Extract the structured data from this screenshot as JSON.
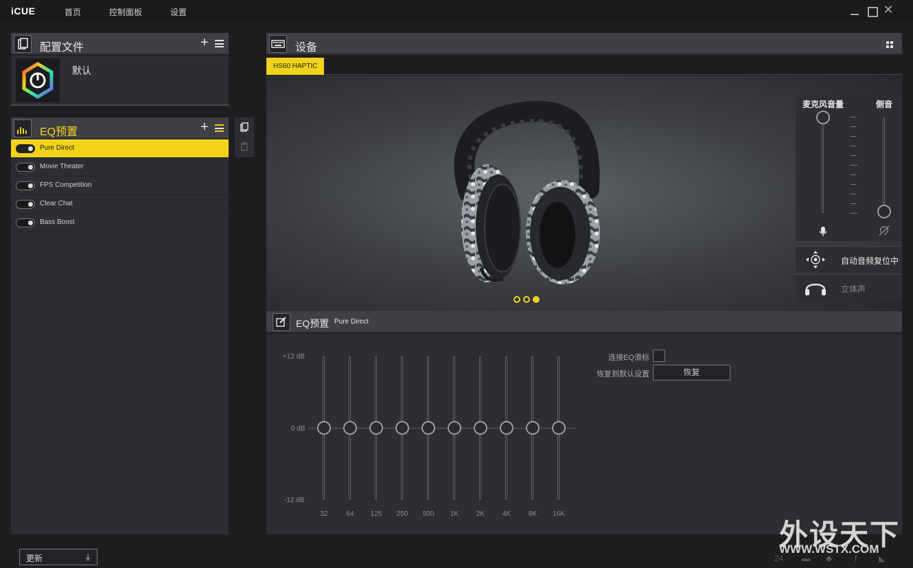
{
  "app": {
    "name": "iCUE"
  },
  "nav": [
    {
      "label": "首页"
    },
    {
      "label": "控制面板"
    },
    {
      "label": "设置"
    }
  ],
  "profiles": {
    "title": "配置文件",
    "items": [
      {
        "name": "默认"
      }
    ]
  },
  "eq_presets": {
    "title": "EQ预置",
    "items": [
      {
        "name": "Pure Direct",
        "active": true
      },
      {
        "name": "Movie Theater",
        "active": false
      },
      {
        "name": "FPS Competition",
        "active": false
      },
      {
        "name": "Clear Chat",
        "active": false
      },
      {
        "name": "Bass Boost",
        "active": false
      }
    ]
  },
  "update": {
    "label": "更新"
  },
  "devices": {
    "title": "设备",
    "tabs": [
      {
        "label": "HS60 HAPTIC"
      }
    ],
    "carousel_page": 3,
    "carousel_pages": 3
  },
  "device_controls": {
    "mic_volume": {
      "label": "麦克风音量",
      "level": 1.0
    },
    "sidetone": {
      "label": "侧音",
      "level": 0.0
    },
    "audio_mode": {
      "label": "自动音频复位中"
    },
    "stereo": {
      "label": "立体声"
    }
  },
  "eq_editor": {
    "title": "EQ预置",
    "preset_name": "Pure Direct",
    "axis": {
      "max": "+12 dB",
      "mid": "0 dB",
      "min": "-12 dB"
    },
    "bands": [
      {
        "label": "32",
        "gain_db": 0
      },
      {
        "label": "64",
        "gain_db": 0
      },
      {
        "label": "125",
        "gain_db": 0
      },
      {
        "label": "250",
        "gain_db": 0
      },
      {
        "label": "500",
        "gain_db": 0
      },
      {
        "label": "1K",
        "gain_db": 0
      },
      {
        "label": "2K",
        "gain_db": 0
      },
      {
        "label": "4K",
        "gain_db": 0
      },
      {
        "label": "8K",
        "gain_db": 0
      },
      {
        "label": "16K",
        "gain_db": 0
      }
    ],
    "link_sliders": {
      "label": "连接EQ滑标",
      "checked": false
    },
    "reset": {
      "label": "恢复到默认设置",
      "button": "恢复"
    }
  },
  "watermark": {
    "text": "外设天下",
    "url": "WWW.WSTX.COM"
  },
  "footer": {
    "counter": "24"
  },
  "colors": {
    "accent": "#f1d31b",
    "background": "#1d1e20",
    "panel": "#2d2e31"
  }
}
